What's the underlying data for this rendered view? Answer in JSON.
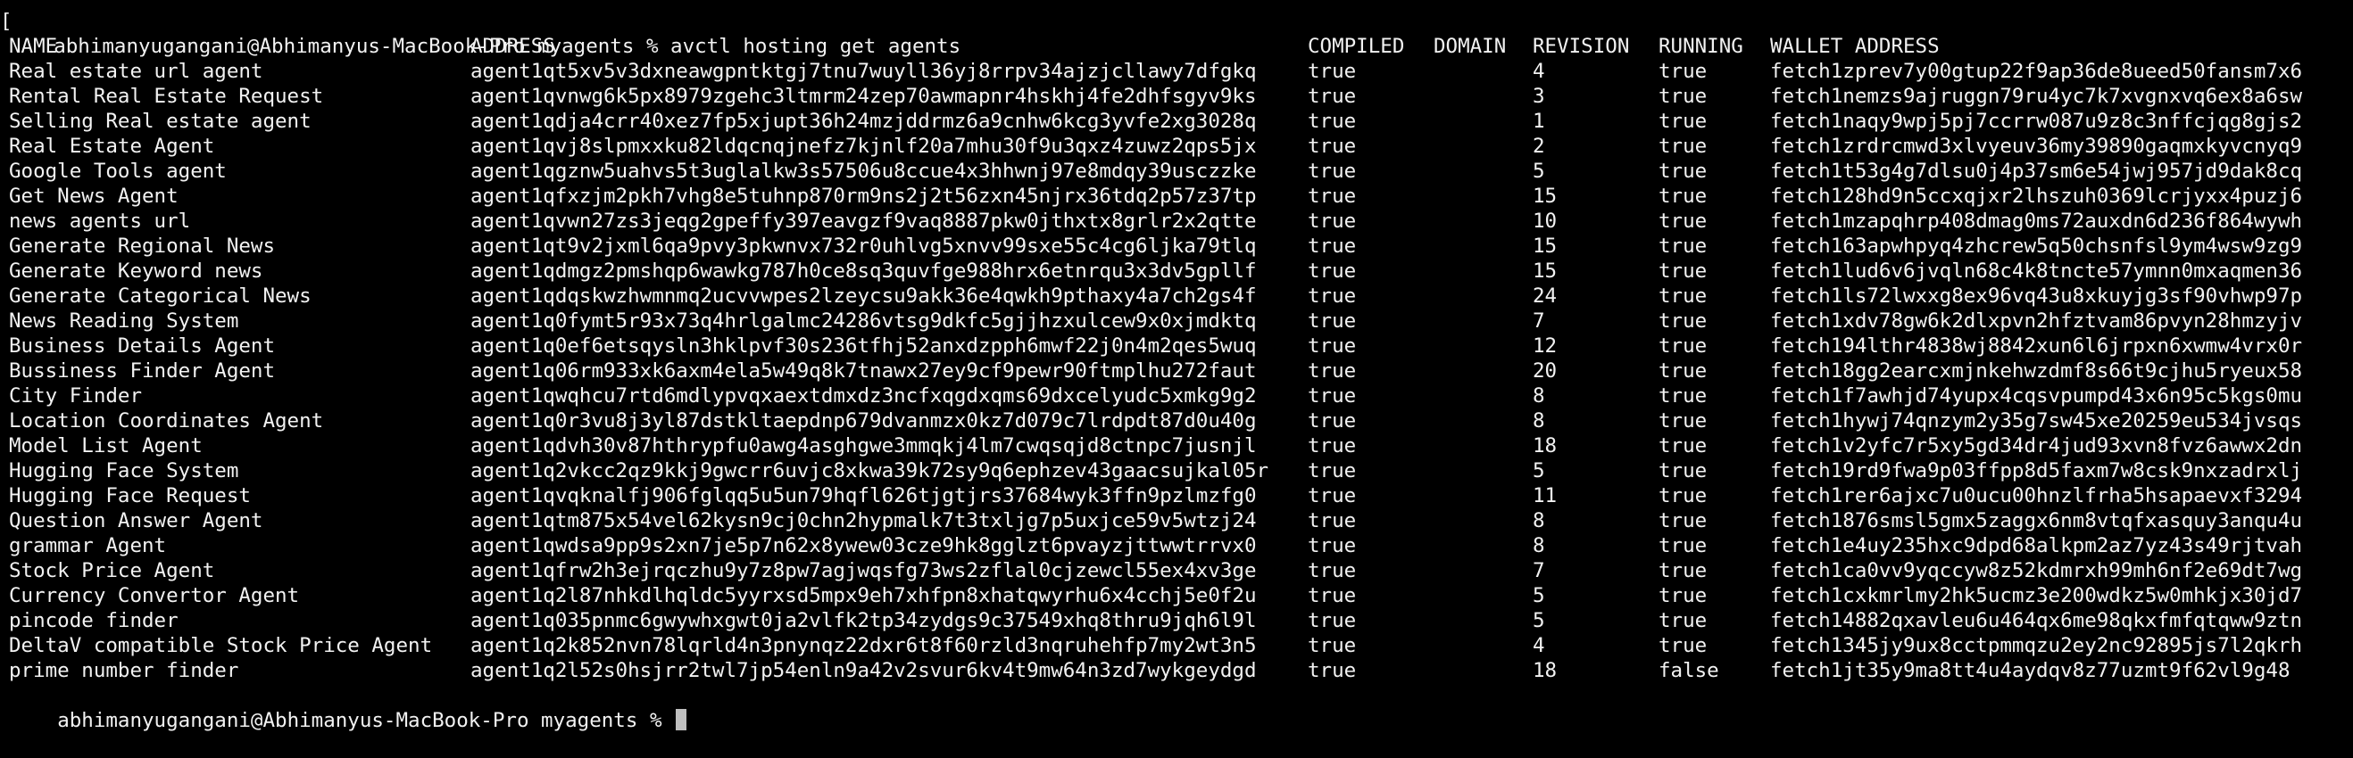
{
  "terminal": {
    "bracket": "[",
    "prompt": "abhimanyugangani@Abhimanyus-MacBook-Pro myagents % ",
    "command": "avctl hosting get agents",
    "final_prompt": "abhimanyugangani@Abhimanyus-MacBook-Pro myagents % ",
    "columns": [
      "NAME",
      "ADDRESS",
      "COMPILED",
      "DOMAIN",
      "REVISION",
      "RUNNING",
      "WALLET ADDRESS"
    ],
    "rows": [
      [
        "Real estate url agent",
        "agent1qt5xv5v3dxneawgpntktgj7tnu7wuyll36yj8rrpv34ajzjcllawy7dfgkq",
        "true",
        "",
        "4",
        "true",
        "fetch1zprev7y00gtup22f9ap36de8ueed50fansm7x6"
      ],
      [
        "Rental Real Estate Request",
        "agent1qvnwg6k5px8979zgehc3ltmrm24zep70awmapnr4hskhj4fe2dhfsgyv9ks",
        "true",
        "",
        "3",
        "true",
        "fetch1nemzs9ajruggn79ru4yc7k7xvgnxvq6ex8a6sw"
      ],
      [
        "Selling Real estate agent",
        "agent1qdja4crr40xez7fp5xjupt36h24mzjddrmz6a9cnhw6kcg3yvfe2xg3028q",
        "true",
        "",
        "1",
        "true",
        "fetch1naqy9wpj5pj7ccrrw087u9z8c3nffcjqg8gjs2"
      ],
      [
        "Real Estate Agent",
        "agent1qvj8slpmxxku82ldqcnqjnefz7kjnlf20a7mhu30f9u3qxz4zuwz2qps5jx",
        "true",
        "",
        "2",
        "true",
        "fetch1zrdrcmwd3xlvyeuv36my39890gaqmxkyvcnyq9"
      ],
      [
        "Google Tools agent",
        "agent1qgznw5uahvs5t3uglalkw3s57506u8ccue4x3hhwnj97e8mdqy39usczzke",
        "true",
        "",
        "5",
        "true",
        "fetch1t53g4g7dlsu0j4p37sm6e54jwj957jd9dak8cq"
      ],
      [
        "Get News Agent",
        "agent1qfxzjm2pkh7vhg8e5tuhnp870rm9ns2j2t56zxn45njrx36tdq2p57z37tp",
        "true",
        "",
        "15",
        "true",
        "fetch128hd9n5ccxqjxr2lhszuh0369lcrjyxx4puzj6"
      ],
      [
        "news agents url",
        "agent1qvwn27zs3jeqg2gpeffy397eavgzf9vaq8887pkw0jthxtx8grlr2x2qtte",
        "true",
        "",
        "10",
        "true",
        "fetch1mzapqhrp408dmag0ms72auxdn6d236f864wywh"
      ],
      [
        "Generate Regional News",
        "agent1qt9v2jxml6qa9pvy3pkwnvx732r0uhlvg5xnvv99sxe55c4cg6ljka79tlq",
        "true",
        "",
        "15",
        "true",
        "fetch163apwhpyq4zhcrew5q50chsnfsl9ym4wsw9zg9"
      ],
      [
        "Generate Keyword news",
        "agent1qdmgz2pmshqp6wawkg787h0ce8sq3quvfge988hrx6etnrqu3x3dv5gpllf",
        "true",
        "",
        "15",
        "true",
        "fetch1lud6v6jvqln68c4k8tncte57ymnn0mxaqmen36"
      ],
      [
        "Generate Categorical News",
        "agent1qdqskwzhwmnmq2ucvvwpes2lzeycsu9akk36e4qwkh9pthaxy4a7ch2gs4f",
        "true",
        "",
        "24",
        "true",
        "fetch1ls72lwxxg8ex96vq43u8xkuyjg3sf90vhwp97p"
      ],
      [
        "News Reading System",
        "agent1q0fymt5r93x73q4hrlgalmc24286vtsg9dkfc5gjjhzxulcew9x0xjmdktq",
        "true",
        "",
        "7",
        "true",
        "fetch1xdv78gw6k2dlxpvn2hfztvam86pvyn28hmzyjv"
      ],
      [
        "Business Details Agent",
        "agent1q0ef6etsqysln3hklpvf30s236tfhj52anxdzpph6mwf22j0n4m2qes5wuq",
        "true",
        "",
        "12",
        "true",
        "fetch194lthr4838wj8842xun6l6jrpxn6xwmw4vrx0r"
      ],
      [
        "Bussiness Finder Agent",
        "agent1q06rm933xk6axm4ela5w49q8k7tnawx27ey9cf9pewr90ftmplhu272faut",
        "true",
        "",
        "20",
        "true",
        "fetch18gg2earcxmjnkehwzdmf8s66t9cjhu5ryeux58"
      ],
      [
        "City Finder",
        "agent1qwqhcu7rtd6mdlypvqxaextdmxdz3ncfxqgdxqms69dxcelyudc5xmkg9g2",
        "true",
        "",
        "8",
        "true",
        "fetch1f7awhjd74yupx4cqsvpumpd43x6n95c5kgs0mu"
      ],
      [
        "Location Coordinates Agent",
        "agent1q0r3vu8j3yl87dstkltaepdnp679dvanmzx0kz7d079c7lrdpdt87d0u40g",
        "true",
        "",
        "8",
        "true",
        "fetch1hywj74qnzym2y35g7sw45xe20259eu534jvsqs"
      ],
      [
        "Model List Agent",
        "agent1qdvh30v87hthrypfu0awg4asghgwe3mmqkj4lm7cwqsqjd8ctnpc7jusnjl",
        "true",
        "",
        "18",
        "true",
        "fetch1v2yfc7r5xy5gd34dr4jud93xvn8fvz6awwx2dn"
      ],
      [
        "Hugging Face System",
        "agent1q2vkcc2qz9kkj9gwcrr6uvjc8xkwa39k72sy9q6ephzev43gaacsujkal05r",
        "true",
        "",
        "5",
        "true",
        "fetch19rd9fwa9p03ffpp8d5faxm7w8csk9nxzadrxlj"
      ],
      [
        "Hugging Face Request",
        "agent1qvqknalfj906fglqq5u5un79hqfl626tjgtjrs37684wyk3ffn9pzlmzfg0",
        "true",
        "",
        "11",
        "true",
        "fetch1rer6ajxc7u0ucu00hnzlfrha5hsapaevxf3294"
      ],
      [
        "Question Answer Agent",
        "agent1qtm875x54vel62kysn9cj0chn2hypmalk7t3txljg7p5uxjce59v5wtzj24",
        "true",
        "",
        "8",
        "true",
        "fetch1876smsl5gmx5zaggx6nm8vtqfxasquy3anqu4u"
      ],
      [
        "grammar Agent",
        "agent1qwdsa9pp9s2xn7je5p7n62x8ywew03cze9hk8gglzt6pvayzjttwwtrrvx0",
        "true",
        "",
        "8",
        "true",
        "fetch1e4uy235hxc9dpd68alkpm2az7yz43s49rjtvah"
      ],
      [
        "Stock Price Agent",
        "agent1qfrw2h3ejrqczhu9y7z8pw7agjwqsfg73ws2zflal0cjzewcl55ex4xv3ge",
        "true",
        "",
        "7",
        "true",
        "fetch1ca0vv9yqccyw8z52kdmrxh99mh6nf2e69dt7wg"
      ],
      [
        "Currency Convertor Agent",
        "agent1q2l87nhkdlhqldc5yyrxsd5mpx9eh7xhfpn8xhatqwyrhu6x4cchj5e0f2u",
        "true",
        "",
        "5",
        "true",
        "fetch1cxkmrlmy2hk5ucmz3e200wdkz5w0mhkjx30jd7"
      ],
      [
        "pincode finder",
        "agent1q035pnmc6gwywhxgwt0ja2vlfk2tp34zydgs9c37549xhq8thru9jqh6l9l",
        "true",
        "",
        "5",
        "true",
        "fetch14882qxavleu6u464qx6me98qkxfmfqtqww9ztn"
      ],
      [
        "DeltaV compatible Stock Price Agent",
        "agent1q2k852nvn78lqrld4n3pnynqz22dxr6t8f60rzld3nqruhehfp7my2wt3n5",
        "true",
        "",
        "4",
        "true",
        "fetch1345jy9ux8cctpmmqzu2ey2nc92895js7l2qkrh"
      ],
      [
        "prime number finder",
        "agent1q2l52s0hsjrr2twl7jp54enln9a42v2svur6kv4t9mw64n3zd7wykgeydgd",
        "true",
        "",
        "18",
        "false",
        "fetch1jt35y9ma8tt4u4aydqv8z77uzmt9f62vl9g48"
      ]
    ]
  },
  "colors": {
    "background": "#000000",
    "text": "#f2f2f2",
    "cursor": "#bfbfbf"
  }
}
